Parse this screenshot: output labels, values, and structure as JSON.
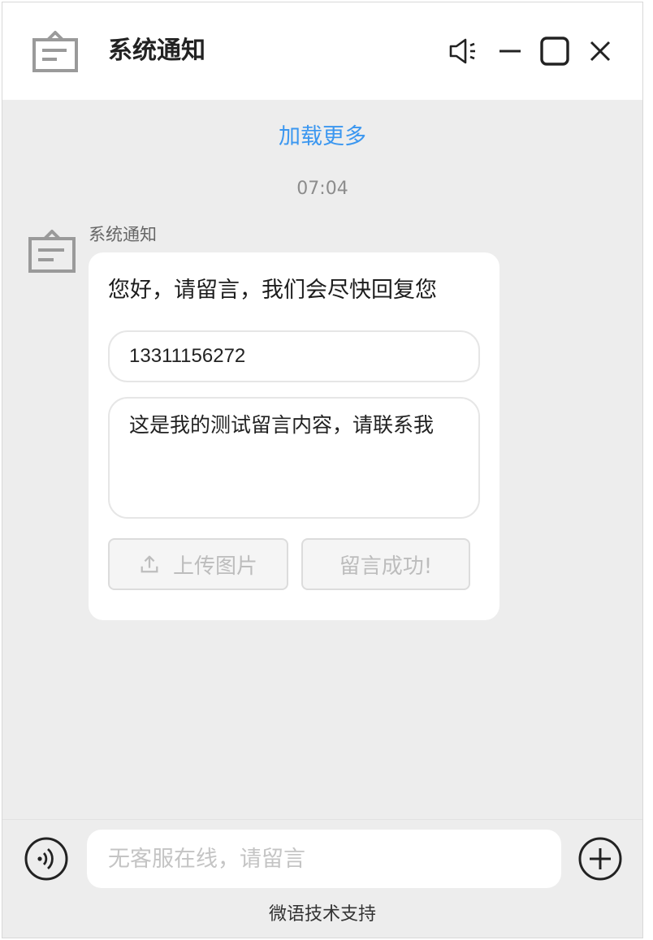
{
  "header": {
    "title": "系统通知",
    "icons": [
      "notification-box-icon",
      "speaker-mute-icon",
      "minimize-icon",
      "maximize-icon",
      "close-icon"
    ]
  },
  "chat": {
    "load_more": "加载更多",
    "timestamp": "07:04",
    "message": {
      "sender": "系统通知",
      "text": "您好，请留言，我们会尽快回复您",
      "phone_value": "13311156272",
      "message_value": "这是我的测试留言内容，请联系我",
      "upload_label": "上传图片",
      "submit_label": "留言成功!"
    }
  },
  "footer": {
    "input_placeholder": "无客服在线，请留言",
    "powered_by": "微语技术支持"
  },
  "colors": {
    "accent": "#3b97f0",
    "background": "#ededed",
    "bubble": "#ffffff"
  }
}
